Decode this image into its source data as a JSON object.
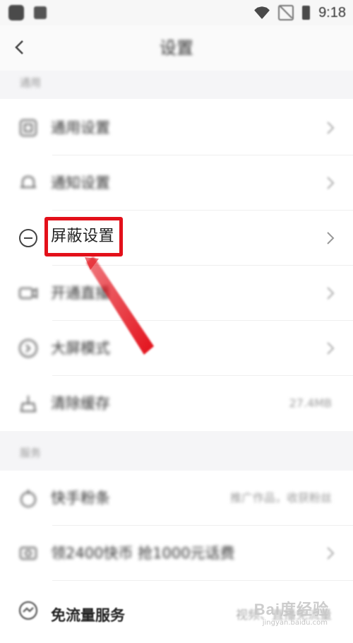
{
  "status_bar": {
    "time": "9:18"
  },
  "nav": {
    "title": "设置"
  },
  "section_general": {
    "title": "通用",
    "items": [
      {
        "label": "通用设置",
        "icon": "grid-icon"
      },
      {
        "label": "通知设置",
        "icon": "bell-icon"
      },
      {
        "label": "屏蔽设置",
        "icon": "block-icon"
      },
      {
        "label": "开通直播",
        "icon": "video-icon"
      },
      {
        "label": "大屏模式",
        "icon": "display-icon"
      },
      {
        "label": "清除缓存",
        "icon": "broom-icon",
        "value": "27.4MB"
      }
    ]
  },
  "section_service": {
    "title": "服务",
    "items": [
      {
        "label": "快手粉条",
        "icon": "fan-icon",
        "value": "推广作品，收获粉丝"
      },
      {
        "label": "领2400快币 抢1000元话费",
        "icon": "coupon-icon"
      },
      {
        "label": "免流量服务",
        "icon": "data-icon",
        "value": "视频、直播免流量"
      }
    ]
  },
  "watermark": {
    "text": "Bai度经验",
    "sub": "jingyan.baidu.com"
  },
  "colors": {
    "highlight": "#e3101a",
    "background": "#ffffff",
    "section_bg": "#f5f5f7"
  }
}
